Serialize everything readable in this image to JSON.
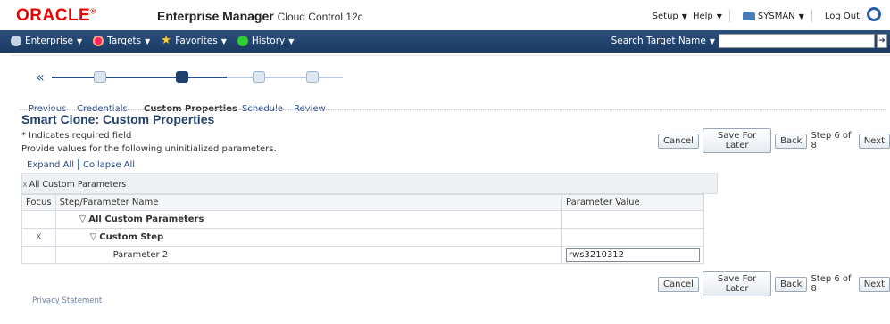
{
  "header": {
    "brand": "ORACLE",
    "product_bold": "Enterprise Manager",
    "product_sub": "Cloud Control 12c",
    "setup": "Setup",
    "help": "Help",
    "user": "SYSMAN",
    "logout": "Log Out"
  },
  "nav": {
    "items": [
      "Enterprise",
      "Targets",
      "Favorites",
      "History"
    ],
    "search_label": "Search Target Name",
    "search_placeholder": ""
  },
  "train": {
    "previous": "Previous",
    "steps": [
      "Credentials",
      "Custom Properties",
      "Schedule",
      "Review"
    ],
    "current_index": 1
  },
  "page": {
    "title": "Smart Clone: Custom Properties",
    "required_note": "* Indicates required field",
    "description": "Provide values for the following uninitialized parameters.",
    "expand_all": "Expand All",
    "collapse_all": "Collapse All"
  },
  "buttons": {
    "cancel": "Cancel",
    "save_later": "Save For Later",
    "back": "Back",
    "step_text": "Step 6 of 8",
    "next": "Next"
  },
  "table": {
    "group_label": "All Custom Parameters",
    "headers": [
      "Focus",
      "Step/Parameter Name",
      "Parameter Value"
    ],
    "rows": [
      {
        "focus": "",
        "name": "All Custom Parameters",
        "value": ""
      },
      {
        "focus": "X",
        "name": "Custom Step",
        "value": ""
      },
      {
        "focus": "",
        "name": "Parameter 2",
        "value": "rws3210312"
      }
    ]
  },
  "footer": {
    "privacy": "Privacy Statement"
  }
}
